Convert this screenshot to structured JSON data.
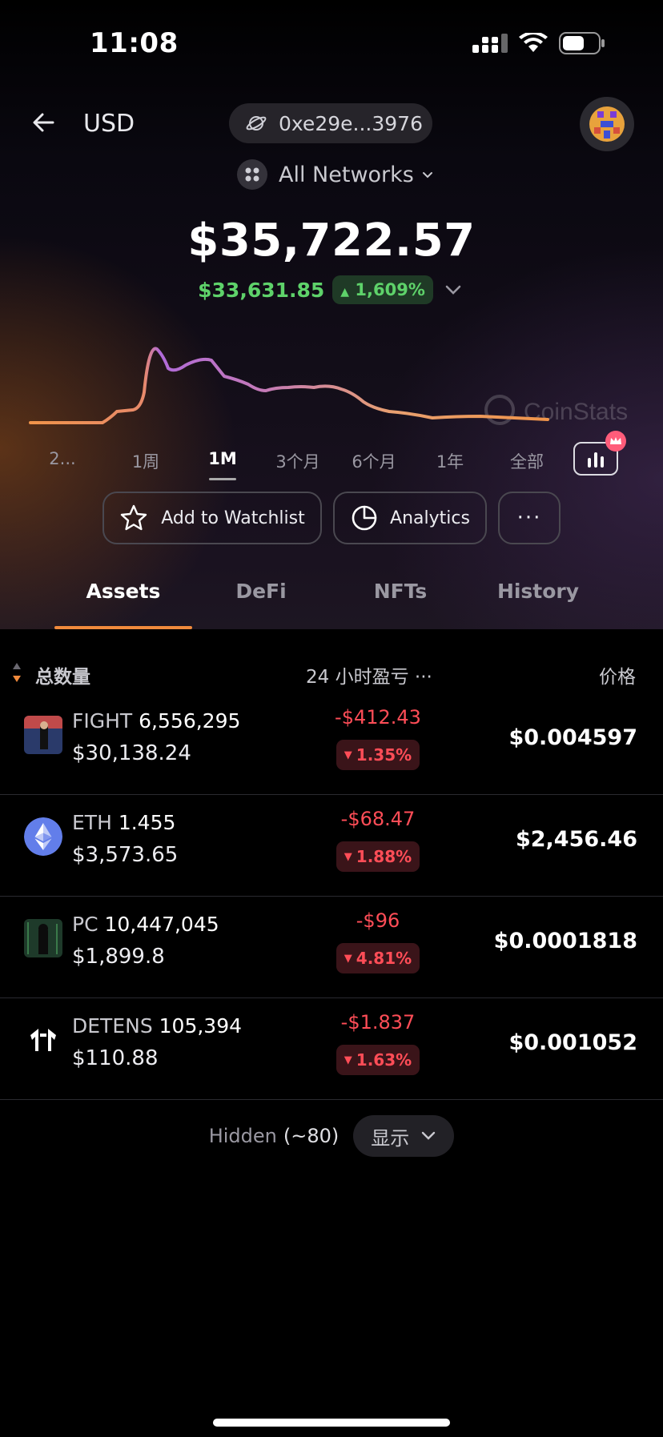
{
  "status_bar": {
    "time": "11:08"
  },
  "header": {
    "currency": "USD",
    "wallet_address": "0xe29e...3976",
    "network_selector": "All Networks"
  },
  "portfolio": {
    "total_value": "$35,722.57",
    "change_amount": "$33,631.85",
    "change_percent": "1,609%",
    "change_direction": "up"
  },
  "chart": {
    "watermark": "CoinStats",
    "time_ranges": [
      {
        "label": "2...",
        "active": false
      },
      {
        "label": "1周",
        "active": false
      },
      {
        "label": "1M",
        "active": true
      },
      {
        "label": "3个月",
        "active": false
      },
      {
        "label": "6个月",
        "active": false
      },
      {
        "label": "1年",
        "active": false
      },
      {
        "label": "全部",
        "active": false
      }
    ]
  },
  "actions": {
    "watchlist": "Add to Watchlist",
    "analytics": "Analytics",
    "more": "···"
  },
  "tabs": [
    {
      "label": "Assets",
      "active": true
    },
    {
      "label": "DeFi",
      "active": false
    },
    {
      "label": "NFTs",
      "active": false
    },
    {
      "label": "History",
      "active": false
    }
  ],
  "table": {
    "headers": {
      "amount": "总数量",
      "pnl": "24 小时盈亏 ···",
      "price": "价格"
    },
    "rows": [
      {
        "symbol": "FIGHT",
        "quantity": "6,556,295",
        "value": "$30,138.24",
        "pnl": "-$412.43",
        "pnl_pct": "1.35%",
        "price": "$0.004597",
        "icon": "fight-token-icon"
      },
      {
        "symbol": "ETH",
        "quantity": "1.455",
        "value": "$3,573.65",
        "pnl": "-$68.47",
        "pnl_pct": "1.88%",
        "price": "$2,456.46",
        "icon": "ethereum-icon"
      },
      {
        "symbol": "PC",
        "quantity": "10,447,045",
        "value": "$1,899.8",
        "pnl": "-$96",
        "pnl_pct": "4.81%",
        "price": "$0.0001818",
        "icon": "pc-token-icon"
      },
      {
        "symbol": "DETENS",
        "quantity": "105,394",
        "value": "$110.88",
        "pnl": "-$1.837",
        "pnl_pct": "1.63%",
        "price": "$0.001052",
        "icon": "detens-token-icon"
      }
    ]
  },
  "hidden": {
    "label": "Hidden",
    "count": "(~80)",
    "show_label": "显示"
  },
  "colors": {
    "positive": "#5ed26a",
    "negative": "#ff4d57",
    "accent": "#f08a3c"
  }
}
